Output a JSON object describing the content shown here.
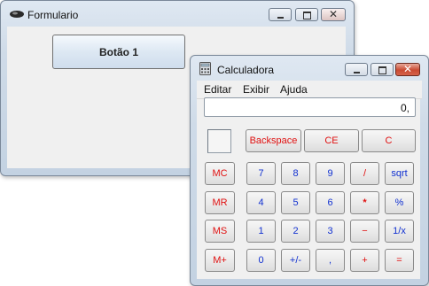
{
  "formulario": {
    "title": "Formulario",
    "button1_label": "Botão 1"
  },
  "calculadora": {
    "title": "Calculadora",
    "menu": [
      "Editar",
      "Exibir",
      "Ajuda"
    ],
    "display_value": "0,",
    "keys": {
      "backspace": "Backspace",
      "ce": "CE",
      "c": "C",
      "mc": "MC",
      "mr": "MR",
      "ms": "MS",
      "mplus": "M+",
      "d7": "7",
      "d8": "8",
      "d9": "9",
      "div": "/",
      "sqrt": "sqrt",
      "d4": "4",
      "d5": "5",
      "d6": "6",
      "mul": "*",
      "pct": "%",
      "d1": "1",
      "d2": "2",
      "d3": "3",
      "sub": "−",
      "recip": "1/x",
      "d0": "0",
      "sign": "+/-",
      "dec": ",",
      "add": "+",
      "eq": "="
    }
  },
  "colors": {
    "key_red": "#e01010",
    "key_blue": "#1030d0",
    "close_red": "#c94a32"
  },
  "icons": [
    "formulario-app-icon",
    "calculator-app-icon",
    "minimize-icon",
    "maximize-icon",
    "close-icon"
  ]
}
